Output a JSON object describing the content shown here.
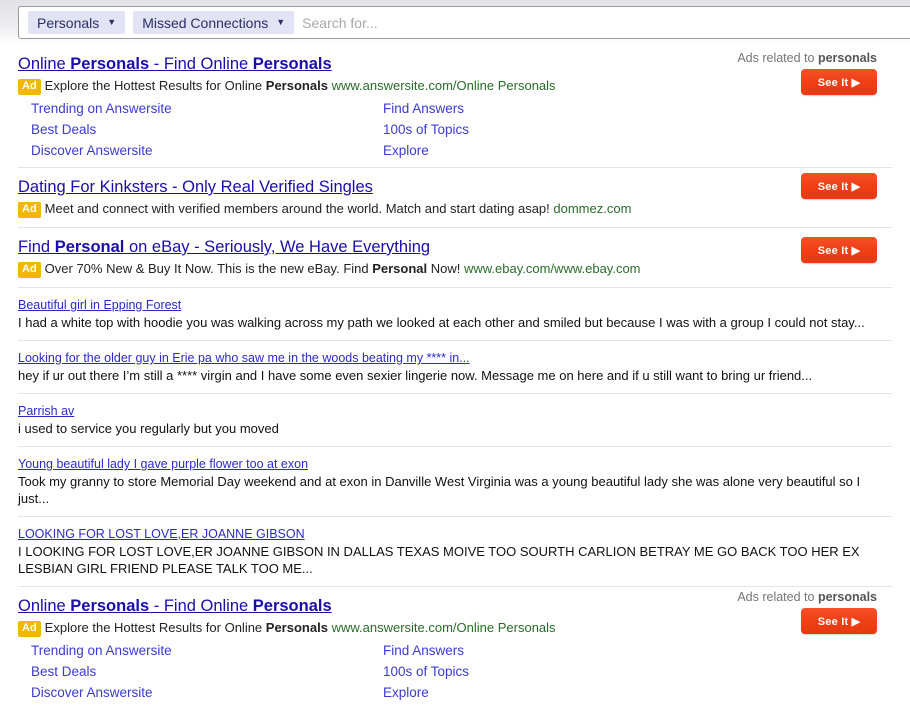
{
  "search": {
    "filters": [
      {
        "label": "Personals",
        "icon": "chevron-down-icon"
      },
      {
        "label": "Missed Connections",
        "icon": "chevron-down-icon"
      }
    ],
    "placeholder": "Search for...",
    "value": ""
  },
  "colors": {
    "link": "#1a0dab",
    "ad_badge": "#f2b705",
    "cta": "#ef3f16",
    "url": "#2a6b2a",
    "pill_bg": "#e2e3f5"
  },
  "ads_related_label": "Ads related to ",
  "ads_related_term": "personals",
  "cta_label": "See It ▶",
  "ad_badge_label": "Ad",
  "top_ads": [
    {
      "title_parts": [
        {
          "text": "Online ",
          "bold": false
        },
        {
          "text": "Personals",
          "bold": true
        },
        {
          "text": " - Find Online ",
          "bold": false
        },
        {
          "text": "Personals",
          "bold": true
        },
        {
          "text": " ",
          "bold": false
        }
      ],
      "desc_parts": [
        {
          "text": "Explore the Hottest Results for Online ",
          "bold": false
        },
        {
          "text": "Personals",
          "bold": true
        },
        {
          "text": " ",
          "bold": false
        }
      ],
      "url": "www.answersite.com/Online Personals",
      "sitelinks": [
        "Trending on Answersite",
        "Find Answers",
        "Best Deals",
        "100s of Topics",
        "Discover Answersite",
        "Explore"
      ]
    },
    {
      "title_parts": [
        {
          "text": "Dating For Kinksters - Only Real Verified Singles ",
          "bold": false
        }
      ],
      "desc_parts": [
        {
          "text": "Meet and connect with verified members around the world. Match and start dating asap! ",
          "bold": false
        }
      ],
      "url": "dommez.com",
      "sitelinks": []
    },
    {
      "title_parts": [
        {
          "text": "Find ",
          "bold": false
        },
        {
          "text": "Personal",
          "bold": true
        },
        {
          "text": " on eBay - Seriously, We Have Everything ",
          "bold": false
        }
      ],
      "desc_parts": [
        {
          "text": "Over 70% New & Buy It Now. This is the new eBay. Find ",
          "bold": false
        },
        {
          "text": "Personal",
          "bold": true
        },
        {
          "text": " Now! ",
          "bold": false
        }
      ],
      "url": "www.ebay.com/www.ebay.com",
      "sitelinks": []
    }
  ],
  "results": [
    {
      "title": "Beautiful girl in Epping Forest",
      "snippet": "I had a white top with hoodie you was walking across my path we looked at each other and smiled but because I was with a group I could not stay..."
    },
    {
      "title": "Looking for the older guy in Erie pa who saw me in the woods beating my **** in...",
      "snippet": "hey if ur out there I’m still a **** virgin and I have some even sexier lingerie now. Message me on here and if u still want to bring ur friend..."
    },
    {
      "title": "Parrish av",
      "snippet": "i used to service you regularly but you moved"
    },
    {
      "title": "Young beautiful lady I gave purple flower too at exon",
      "snippet": "Took my granny to store Memorial Day weekend and at exon in Danville West Virginia was a young beautiful lady she was alone very beautiful so I just..."
    },
    {
      "title": "LOOKING FOR LOST LOVE,ER JOANNE GIBSON",
      "snippet": "I LOOKING FOR LOST LOVE,ER JOANNE GIBSON IN DALLAS TEXAS MOIVE TOO SOURTH CARLION BETRAY ME GO BACK TOO HER EX LESBIAN GIRL FRIEND PLEASE TALK TOO ME..."
    }
  ],
  "bottom_ad": {
    "title_parts": [
      {
        "text": "Online ",
        "bold": false
      },
      {
        "text": "Personals",
        "bold": true
      },
      {
        "text": " - Find Online ",
        "bold": false
      },
      {
        "text": "Personals",
        "bold": true
      },
      {
        "text": " ",
        "bold": false
      }
    ],
    "desc_parts": [
      {
        "text": "Explore the Hottest Results for Online ",
        "bold": false
      },
      {
        "text": "Personals",
        "bold": true
      },
      {
        "text": " ",
        "bold": false
      }
    ],
    "url": "www.answersite.com/Online Personals",
    "sitelinks": [
      "Trending on Answersite",
      "Find Answers",
      "Best Deals",
      "100s of Topics",
      "Discover Answersite",
      "Explore"
    ]
  }
}
